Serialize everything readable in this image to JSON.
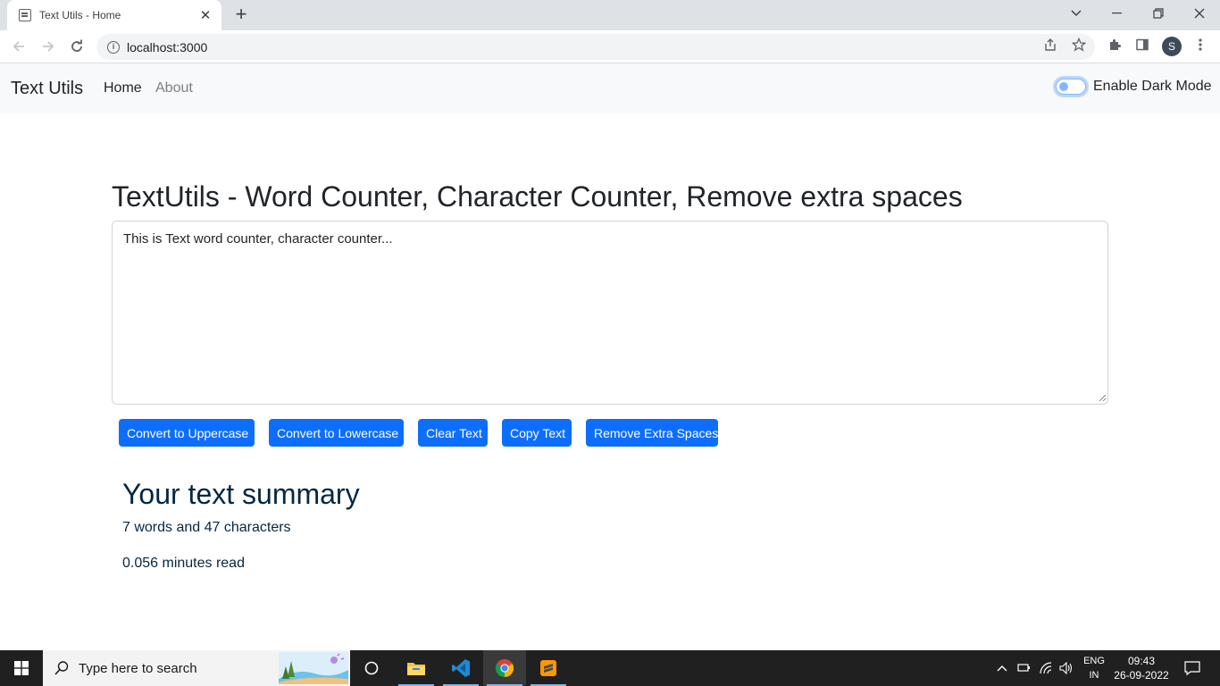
{
  "browser": {
    "tab_title": "Text Utils - Home",
    "url": "localhost:3000",
    "profile_initial": "S"
  },
  "navbar": {
    "brand": "Text Utils",
    "links": [
      {
        "label": "Home",
        "active": true
      },
      {
        "label": "About",
        "active": false
      }
    ],
    "dark_mode_label": "Enable Dark Mode",
    "dark_mode_enabled": false
  },
  "main": {
    "heading": "TextUtils - Word Counter, Character Counter, Remove extra spaces",
    "textarea_value": "This is Text word counter, character counter...",
    "buttons": [
      "Convert to Uppercase",
      "Convert to Lowercase",
      "Clear Text",
      "Copy Text",
      "Remove Extra Spaces"
    ]
  },
  "summary": {
    "heading": "Your text summary",
    "counts": "7 words and 47 characters",
    "read_time": "0.056 minutes read"
  },
  "taskbar": {
    "search_placeholder": "Type here to search",
    "lang_top": "ENG",
    "lang_bottom": "IN",
    "time": "09:43",
    "date": "26-09-2022"
  },
  "colors": {
    "primary": "#0d6efd",
    "summary_text": "#042743",
    "navbar_bg": "#f8f9fa",
    "taskbar_bg": "#202020"
  }
}
